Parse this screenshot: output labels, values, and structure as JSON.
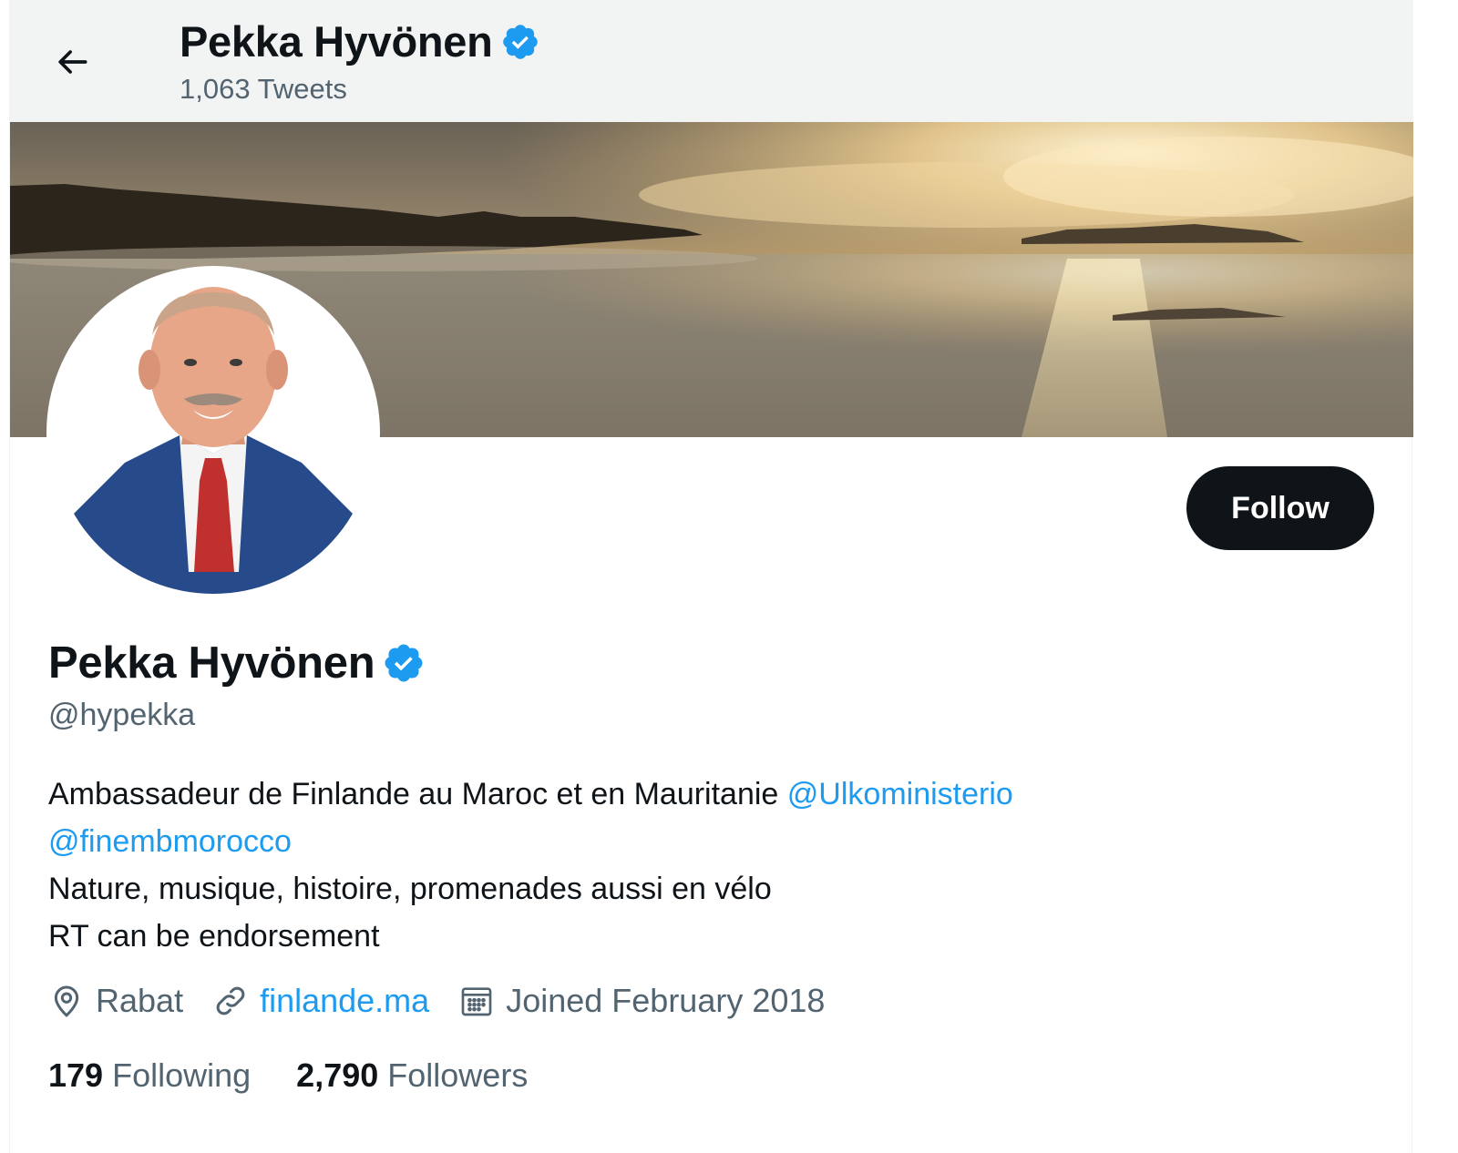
{
  "header": {
    "title": "Pekka Hyvönen",
    "tweet_count": "1,063 Tweets"
  },
  "profile": {
    "name": "Pekka Hyvönen",
    "handle": "@hypekka",
    "follow_label": "Follow",
    "bio": {
      "line1_text": "Ambassadeur de Finlande au Maroc et en Mauritanie ",
      "line1_mention": "@Ulkoministerio",
      "line2_mention": "@finembmorocco",
      "line3_text": "Nature, musique, histoire, promenades aussi en vélo",
      "line4_text": "RT can be endorsement"
    },
    "location": "Rabat",
    "website": "finlande.ma",
    "joined": "Joined February 2018",
    "following_count": "179",
    "following_label": "Following",
    "followers_count": "2,790",
    "followers_label": "Followers"
  },
  "icons": {
    "back": "arrow-left-icon",
    "verified": "verified-badge-icon",
    "location": "location-pin-icon",
    "link": "link-icon",
    "calendar": "calendar-icon"
  },
  "colors": {
    "accent": "#1d9bf0",
    "text": "#0f1419",
    "secondary": "#536471",
    "button": "#0f1419",
    "header_bg": "#f2f3f3"
  }
}
